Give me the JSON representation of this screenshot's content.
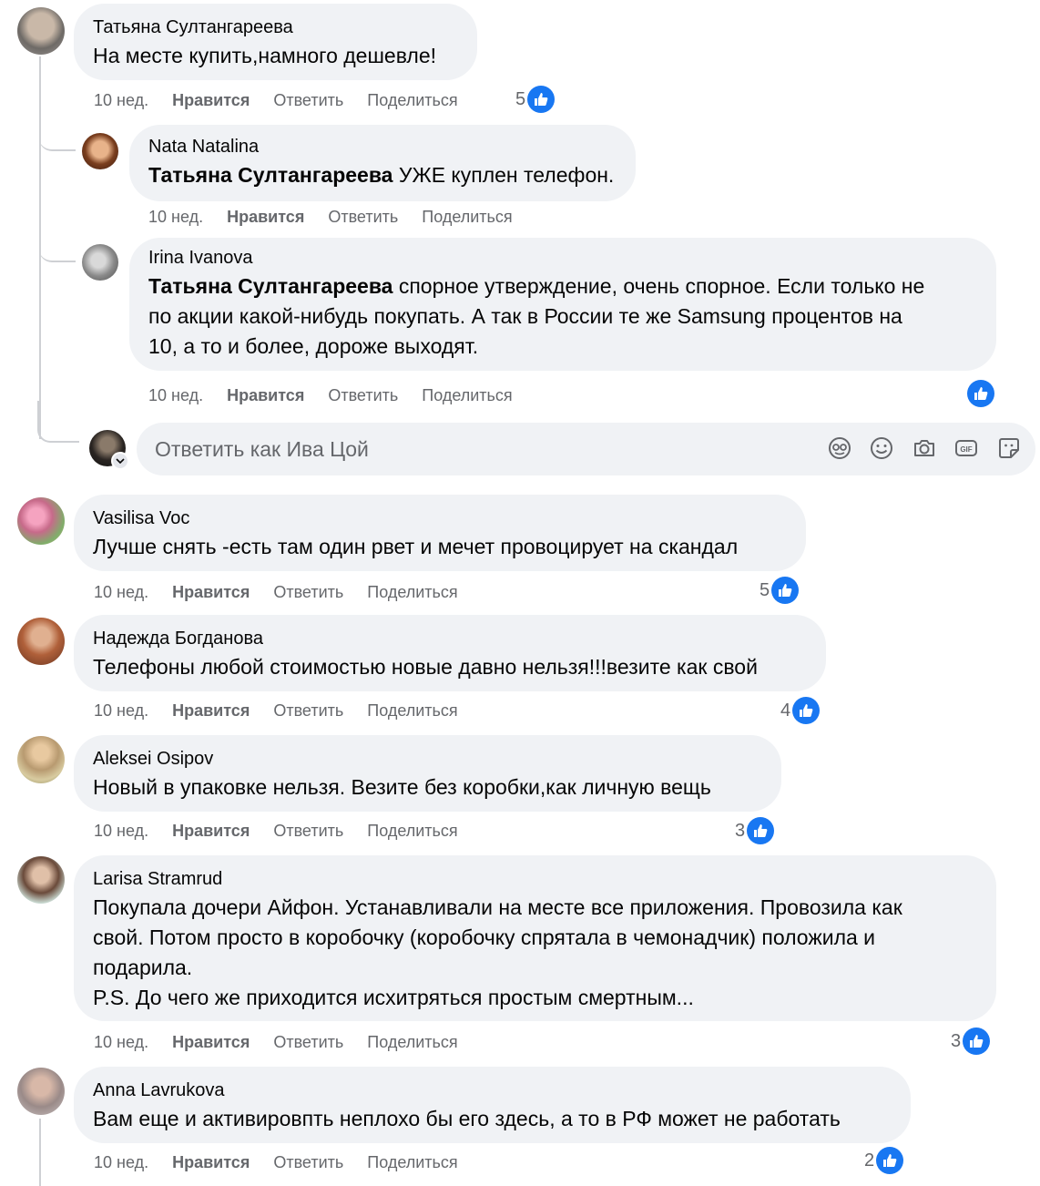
{
  "comments": [
    {
      "author": "Татьяна Султангареева",
      "text": "На месте купить,намного дешевле!",
      "time": "10 нед.",
      "like": "Нравится",
      "reply": "Ответить",
      "share": "Поделиться",
      "reaction_count": "5",
      "replies": [
        {
          "author": "Nata Natalina",
          "mention": "Татьяна Султангареева",
          "text": " УЖЕ куплен телефон.",
          "time": "10 нед.",
          "like": "Нравится",
          "reply": "Ответить",
          "share": "Поделиться"
        },
        {
          "author": "Irina Ivanova",
          "mention": "Татьяна Султангареева",
          "text_line1": " спорное утверждение, очень спорное. Если только не",
          "text_line2": "по акции какой-нибудь покупать. А так в России те же Samsung процентов на",
          "text_line3": "10, а то и более, дороже выходят.",
          "time": "10 нед.",
          "like": "Нравится",
          "reply": "Ответить",
          "share": "Поделиться",
          "reaction_count": ""
        }
      ],
      "reply_box": {
        "placeholder": "Ответить как Ива Цой",
        "icons": [
          "avatar-sticker-icon",
          "emoji-icon",
          "camera-icon",
          "gif-icon",
          "sticker-icon"
        ]
      }
    },
    {
      "author": "Vasilisa Voc",
      "text": "Лучше снять -есть там один рвет и мечет провоцирует на скандал",
      "time": "10 нед.",
      "like": "Нравится",
      "reply": "Ответить",
      "share": "Поделиться",
      "reaction_count": "5"
    },
    {
      "author": "Надежда Богданова",
      "text": "Телефоны любой стоимостью новые давно нельзя!!!везите как свой",
      "time": "10 нед.",
      "like": "Нравится",
      "reply": "Ответить",
      "share": "Поделиться",
      "reaction_count": "4"
    },
    {
      "author": "Aleksei Osipov",
      "text": "Новый в упаковке нельзя. Везите без коробки,как личную вещь",
      "time": "10 нед.",
      "like": "Нравится",
      "reply": "Ответить",
      "share": "Поделиться",
      "reaction_count": "3"
    },
    {
      "author": "Larisa Stramrud",
      "text_line1": "Покупала дочери Айфон. Устанавливали на месте все приложения. Провозила как",
      "text_line2": "свой. Потом просто в коробочку (коробочку спрятала в чемонадчик) положила и",
      "text_line3": "подарила.",
      "text_line4": "P.S. До чего же приходится исхитряться простым смертным...",
      "time": "10 нед.",
      "like": "Нравится",
      "reply": "Ответить",
      "share": "Поделиться",
      "reaction_count": "3"
    },
    {
      "author": "Anna Lavrukova",
      "text": "Вам еще и активировпть неплохо бы его здесь, а то в РФ может не работать",
      "time": "10 нед.",
      "like": "Нравится",
      "reply": "Ответить",
      "share": "Поделиться",
      "reaction_count": "2"
    }
  ],
  "colors": {
    "bubble": "#f0f2f5",
    "meta_text": "#65676b",
    "like_blue": "#1877f2",
    "thread_line": "#ced0d4"
  }
}
